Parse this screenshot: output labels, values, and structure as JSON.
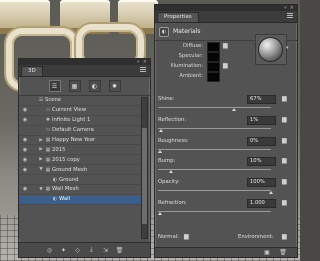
{
  "panel3d": {
    "tab": "3D",
    "tree": [
      {
        "label": "Scene",
        "eye": false,
        "twisty": "",
        "icon": "scene-icon",
        "indent": 0,
        "selected": false
      },
      {
        "label": "Current View",
        "eye": true,
        "twisty": "",
        "icon": "camera-icon",
        "indent": 1,
        "selected": false
      },
      {
        "label": "Infinite Light 1",
        "eye": true,
        "twisty": "",
        "icon": "light-icon",
        "indent": 1,
        "selected": false
      },
      {
        "label": "Default Camera",
        "eye": false,
        "twisty": "",
        "icon": "camera-icon",
        "indent": 1,
        "selected": false
      },
      {
        "label": "Happy New Year",
        "eye": true,
        "twisty": "▶",
        "icon": "mesh-icon",
        "indent": 1,
        "selected": false
      },
      {
        "label": "2015",
        "eye": true,
        "twisty": "▶",
        "icon": "mesh-icon",
        "indent": 1,
        "selected": false
      },
      {
        "label": "2015 copy",
        "eye": true,
        "twisty": "▶",
        "icon": "mesh-icon",
        "indent": 1,
        "selected": false
      },
      {
        "label": "Ground Mesh",
        "eye": true,
        "twisty": "▼",
        "icon": "mesh-icon",
        "indent": 1,
        "selected": false
      },
      {
        "label": "Ground",
        "eye": false,
        "twisty": "",
        "icon": "material-icon",
        "indent": 2,
        "selected": false
      },
      {
        "label": "Wall Mesh",
        "eye": true,
        "twisty": "▼",
        "icon": "mesh-icon",
        "indent": 1,
        "selected": false
      },
      {
        "label": "Wall",
        "eye": false,
        "twisty": "",
        "icon": "material-icon",
        "indent": 2,
        "selected": true
      }
    ]
  },
  "properties": {
    "tab": "Properties",
    "title": "Materials",
    "swatches": [
      {
        "label": "Diffuse:",
        "color": "#050505"
      },
      {
        "label": "Specular:",
        "color": "#050505"
      },
      {
        "label": "Illumination:",
        "color": "#050505"
      },
      {
        "label": "Ambient:",
        "color": "#050505"
      }
    ],
    "sliders": [
      {
        "label": "Shine:",
        "value": "67%",
        "fraction": 0.67
      },
      {
        "label": "Reflection:",
        "value": "1%",
        "fraction": 0.01
      },
      {
        "label": "Roughness:",
        "value": "0%",
        "fraction": 0.0
      },
      {
        "label": "Bump:",
        "value": "10%",
        "fraction": 0.1
      },
      {
        "label": "Opacity:",
        "value": "100%",
        "fraction": 1.0
      },
      {
        "label": "Refraction:",
        "value": "1.000",
        "fraction": 0.0
      }
    ],
    "normal_label": "Normal:",
    "environment_label": "Environment:"
  }
}
